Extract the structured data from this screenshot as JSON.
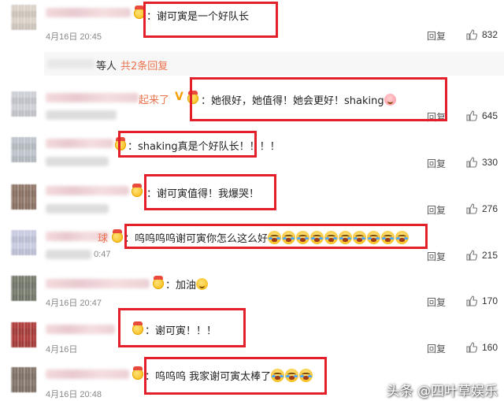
{
  "comments": [
    {
      "text": "：谢可寅是一个好队长",
      "time": "4月16日 20:45",
      "reply": "回复",
      "likes": "832"
    },
    {
      "text": "：她很好，她值得！她会更好！shaking",
      "time": "",
      "reply": "回复",
      "likes": "645",
      "name_suffix": "起来了"
    },
    {
      "text": "：shaking真是个好队长！！！！",
      "time": "",
      "reply": "回复",
      "likes": "330"
    },
    {
      "text": "：谢可寅值得！我爆哭！",
      "time": "",
      "reply": "回复",
      "likes": "276"
    },
    {
      "text": "：呜呜呜呜谢可寅你怎么这么好",
      "time": "0:47",
      "reply": "回复",
      "likes": "215"
    },
    {
      "text": "：加油",
      "time": "4月16日 20:47",
      "reply": "回复",
      "likes": "170"
    },
    {
      "text": "：谢可寅！！！",
      "time": "4月16日",
      "reply": "回复",
      "likes": "160"
    },
    {
      "text": "：呜呜呜 我家谢可寅太棒了",
      "time": "4月16日 20:48",
      "reply": "回复",
      "likes": ""
    }
  ],
  "subreplies": {
    "prefix": "等人",
    "link": "共2条回复"
  },
  "watermark": "头条 @四叶草娱乐",
  "colors": {
    "highlight": "#e3202a",
    "link": "#eb7350"
  }
}
